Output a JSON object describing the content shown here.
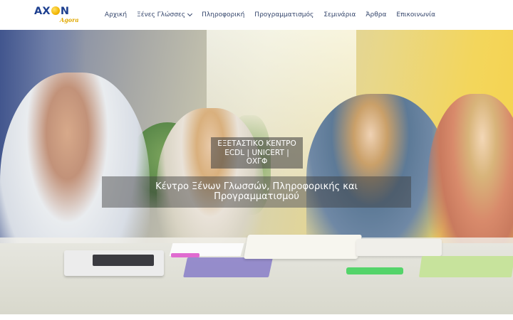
{
  "header": {
    "logo": {
      "main": "AXON",
      "sub": "Agora"
    },
    "nav": [
      {
        "label": "Αρχική"
      },
      {
        "label": "Ξένες Γλώσσες",
        "has_dropdown": true
      },
      {
        "label": "Πληροφορική"
      },
      {
        "label": "Προγραμματισμός"
      },
      {
        "label": "Σεμινάρια"
      },
      {
        "label": "Άρθρα"
      },
      {
        "label": "Επικοινωνία"
      }
    ]
  },
  "hero": {
    "badge_text": "ΕΞΕΤΑΣΤΙΚΟ ΚΕΝΤΡΟ\nECDL | UNICERT |\nΟΧΓΦ",
    "heading": "Κέντρο Ξένων Γλωσσών, Πληροφορικής και\nΠρογραμματισμού",
    "image_description_icon": "classroom-photo"
  },
  "colors": {
    "nav_text": "#34456b",
    "logo_blue": "#1d3f8f",
    "logo_gold": "#e0a800",
    "overlay": "rgba(60,60,60,0.5)"
  }
}
